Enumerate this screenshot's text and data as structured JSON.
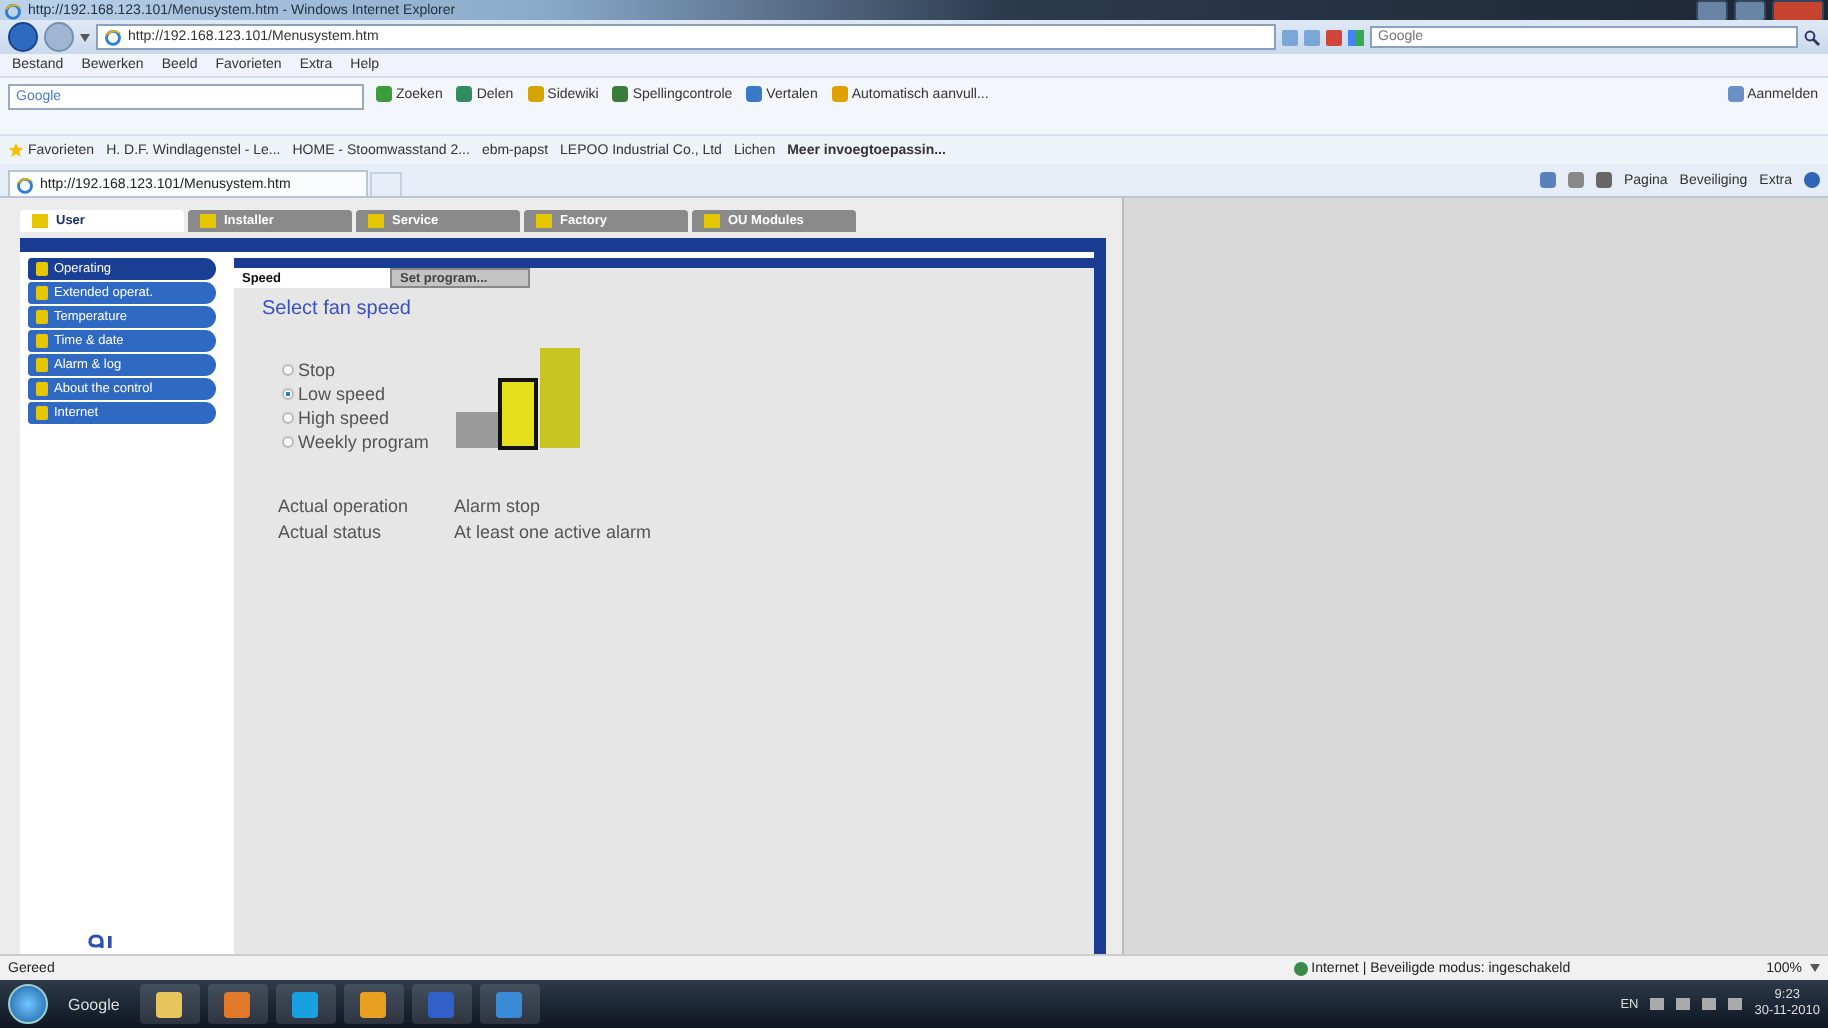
{
  "window": {
    "title": "http://192.168.123.101/Menusystem.htm - Windows Internet Explorer"
  },
  "address_bar": {
    "url": "http://192.168.123.101/Menusystem.htm",
    "search_placeholder": "Google"
  },
  "menu_bar": [
    "Bestand",
    "Bewerken",
    "Beeld",
    "Favorieten",
    "Extra",
    "Help"
  ],
  "toolbar": {
    "search_label": "Google",
    "buttons": [
      "Zoeken",
      "Delen",
      "Sidewiki",
      "Spellingcontrole",
      "Vertalen",
      "Automatisch aanvull..."
    ],
    "sign_in": "Aanmelden"
  },
  "favorites_bar": {
    "label": "Favorieten",
    "links": [
      "H. D.F. Windlagenstel - Le...",
      "HOME - Stoomwasstand 2...",
      "ebm-papst",
      "LEPOO Industrial Co., Ltd",
      "Lichen",
      "Meer invoegtoepassin..."
    ]
  },
  "browser_tab": {
    "title": "http://192.168.123.101/Menusystem.htm"
  },
  "command_bar": [
    "Pagina",
    "Beveiliging",
    "Extra"
  ],
  "app": {
    "tabs": [
      {
        "label": "User",
        "selected": true
      },
      {
        "label": "Installer",
        "selected": false
      },
      {
        "label": "Service",
        "selected": false
      },
      {
        "label": "Factory",
        "selected": false
      },
      {
        "label": "OU Modules",
        "selected": false
      }
    ],
    "menu": [
      {
        "label": "Operating",
        "selected": true
      },
      {
        "label": "Extended operat.",
        "selected": false
      },
      {
        "label": "Temperature",
        "selected": false
      },
      {
        "label": "Time & date",
        "selected": false
      },
      {
        "label": "Alarm & log",
        "selected": false
      },
      {
        "label": "About the control",
        "selected": false
      },
      {
        "label": "Internet",
        "selected": false
      }
    ],
    "subtabs": [
      {
        "label": "Speed",
        "selected": true
      },
      {
        "label": "Set program...",
        "selected": false
      }
    ],
    "heading": "Select fan speed",
    "options": [
      {
        "label": "Stop",
        "selected": false
      },
      {
        "label": "Low speed",
        "selected": true
      },
      {
        "label": "High speed",
        "selected": false
      },
      {
        "label": "Weekly program",
        "selected": false
      }
    ],
    "status": [
      {
        "label": "Actual operation",
        "value": "Alarm stop"
      },
      {
        "label": "Actual status",
        "value": "At least one active alarm"
      }
    ]
  },
  "status_bar": {
    "text": "Gereed",
    "zone": "Internet | Beveiligde modus: ingeschakeld",
    "zoom": "100%"
  },
  "taskbar": {
    "search_label": "Google",
    "language": "EN",
    "time": "9:23",
    "date": "30-11-2010"
  }
}
